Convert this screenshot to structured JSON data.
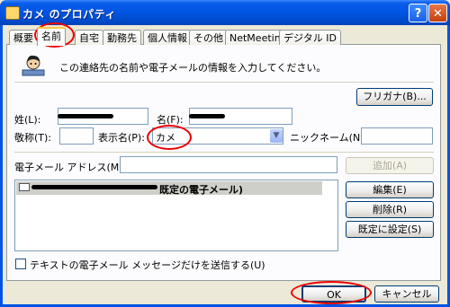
{
  "window": {
    "title": "カメ のプロパティ",
    "help_glyph": "?",
    "close_glyph": "✕"
  },
  "tabs": [
    {
      "label": "概要"
    },
    {
      "label": "名前",
      "active": true
    },
    {
      "label": "自宅"
    },
    {
      "label": "勤務先"
    },
    {
      "label": "個人情報"
    },
    {
      "label": "その他"
    },
    {
      "label": "NetMeeting"
    },
    {
      "label": "デジタル ID"
    }
  ],
  "intro": {
    "text": "この連絡先の名前や電子メールの情報を入力してください。",
    "icon": "person-card-icon"
  },
  "furigana_button": "フリガナ(B)...",
  "name_fields": {
    "last_label": "姓(L):",
    "first_label": "名(F):",
    "last_value": "",
    "first_value": ""
  },
  "row2": {
    "title_label": "敬称(T):",
    "title_value": "",
    "display_label": "表示名(P):",
    "display_value": "カメ",
    "nickname_label": "ニックネーム(N):",
    "nickname_value": ""
  },
  "email": {
    "label": "電子メール アドレス(M):",
    "value": "",
    "add_button": "追加(A)",
    "list_item_suffix": "既定の電子メール)",
    "edit_button": "編集(E)",
    "delete_button": "削除(R)",
    "set_default_button": "既定に設定(S)"
  },
  "plain_text_option": "テキストの電子メール メッセージだけを送信する(U)",
  "footer": {
    "ok": "OK",
    "cancel": "キャンセル"
  },
  "colors": {
    "title_blue": "#0054e3",
    "annotation_red": "#e00000",
    "dialog_bg": "#ece9d8",
    "tab_highlight": "#ffc83c"
  }
}
